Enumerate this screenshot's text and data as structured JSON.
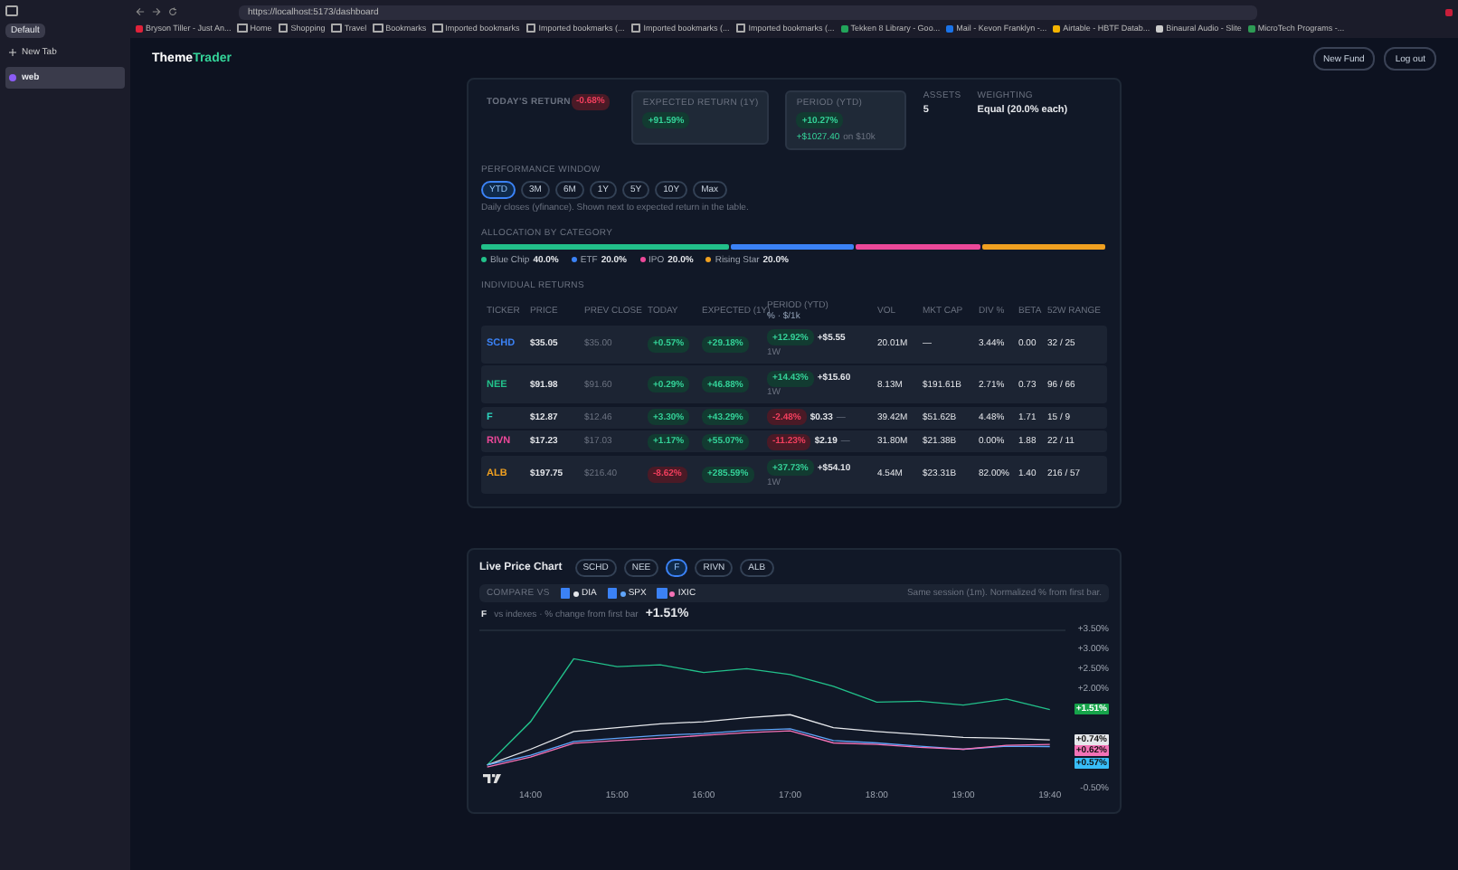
{
  "browser": {
    "url": "https://localhost:5173/dashboard",
    "bookmarks": [
      {
        "label": "Bryson Tiller - Just An...",
        "kind": "site",
        "color": "#e0223a"
      },
      {
        "label": "Home",
        "kind": "folder"
      },
      {
        "label": "Shopping",
        "kind": "folder"
      },
      {
        "label": "Travel",
        "kind": "folder"
      },
      {
        "label": "Bookmarks",
        "kind": "folder"
      },
      {
        "label": "Imported bookmarks",
        "kind": "folder"
      },
      {
        "label": "Imported bookmarks (...",
        "kind": "folder"
      },
      {
        "label": "Imported bookmarks (...",
        "kind": "folder"
      },
      {
        "label": "Imported bookmarks (...",
        "kind": "folder"
      },
      {
        "label": "Tekken 8 Library - Goo...",
        "kind": "site",
        "color": "#22a45a"
      },
      {
        "label": "Mail - Kevon Franklyn -...",
        "kind": "site",
        "color": "#1a73e8"
      },
      {
        "label": "Airtable - HBTF Datab...",
        "kind": "site",
        "color": "#f5b400"
      },
      {
        "label": "Binaural Audio - Slite",
        "kind": "site",
        "color": "#cccccc"
      },
      {
        "label": "MicroTech Programs -...",
        "kind": "site",
        "color": "#2e9b55"
      }
    ]
  },
  "sidebar": {
    "workspace": "Default",
    "new_tab": "New Tab",
    "tabs": [
      {
        "label": "web",
        "selected": true
      }
    ]
  },
  "app": {
    "brand_first": "Theme",
    "brand_second": "Trader",
    "buttons": [
      "New Fund",
      "Log out"
    ]
  },
  "stats": [
    {
      "label": "TODAY'S RETURN",
      "value": "-0.68%",
      "up": false,
      "kind": "pill"
    },
    {
      "label": "EXPECTED RETURN (1Y)",
      "value": "+91.59%",
      "up": true,
      "kind": "boxed"
    },
    {
      "label": "PERIOD (YTD)",
      "value": "+10.27%",
      "up": true,
      "kind": "boxed",
      "amount": "+$1027.40",
      "amount_note": "on $10k"
    },
    {
      "label": "ASSETS",
      "value": "5",
      "kind": "plain"
    },
    {
      "label": "WEIGHTING",
      "value": "Equal (20.0% each)",
      "kind": "plain"
    }
  ],
  "performance": {
    "label": "PERFORMANCE WINDOW",
    "options": [
      {
        "label": "YTD",
        "selected": true
      },
      {
        "label": "3M",
        "selected": false
      },
      {
        "label": "6M",
        "selected": false
      },
      {
        "label": "1Y",
        "selected": false
      },
      {
        "label": "5Y",
        "selected": false
      },
      {
        "label": "10Y",
        "selected": false
      },
      {
        "label": "Max",
        "selected": false
      }
    ],
    "note": "Daily closes (yfinance). Shown next to expected return in the table."
  },
  "allocation": {
    "label": "ALLOCATION BY CATEGORY",
    "categories": [
      {
        "name": "Blue Chip",
        "share": "40.0%",
        "color": "#22c08a"
      },
      {
        "name": "ETF",
        "share": "20.0%",
        "color": "#3b82f6"
      },
      {
        "name": "IPO",
        "share": "20.0%",
        "color": "#ec4899"
      },
      {
        "name": "Rising Star",
        "share": "20.0%",
        "color": "#f0a020"
      }
    ]
  },
  "returns": {
    "label": "INDIVIDUAL RETURNS",
    "columns": [
      "TICKER",
      "PRICE",
      "PREV CLOSE",
      "TODAY",
      "EXPECTED (1Y)",
      "PERIOD (YTD)",
      "VOL",
      "MKT CAP",
      "DIV %",
      "BETA",
      "52W RANGE"
    ],
    "period_sub": "% · $/1k",
    "rows": [
      {
        "ticker": "SCHD",
        "color": "#3b82f6",
        "price": "$35.05",
        "prev_close": "$35.00",
        "today": "+0.57%",
        "today_up": true,
        "expected": "+29.18%",
        "expected_up": true,
        "period": "+12.92%",
        "period_up": true,
        "amount": "+$5.55",
        "note": "1W",
        "vol": "20.01M",
        "mkt_cap": "—",
        "div": "3.44%",
        "beta": "0.00",
        "range": "32 / 25"
      },
      {
        "ticker": "NEE",
        "color": "#22c08a",
        "price": "$91.98",
        "prev_close": "$91.60",
        "today": "+0.29%",
        "today_up": true,
        "expected": "+46.88%",
        "expected_up": true,
        "period": "+14.43%",
        "period_up": true,
        "amount": "+$15.60",
        "note": "1W",
        "vol": "8.13M",
        "mkt_cap": "$191.61B",
        "div": "2.71%",
        "beta": "0.73",
        "range": "96 / 66"
      },
      {
        "ticker": "F",
        "color": "#2dd4bf",
        "price": "$12.87",
        "prev_close": "$12.46",
        "today": "+3.30%",
        "today_up": true,
        "expected": "+43.29%",
        "expected_up": true,
        "period": "-2.48%",
        "period_up": false,
        "amount": "$0.33",
        "note": "—",
        "vol": "39.42M",
        "mkt_cap": "$51.62B",
        "div": "4.48%",
        "beta": "1.71",
        "range": "15 / 9"
      },
      {
        "ticker": "RIVN",
        "color": "#ec4899",
        "price": "$17.23",
        "prev_close": "$17.03",
        "today": "+1.17%",
        "today_up": true,
        "expected": "+55.07%",
        "expected_up": true,
        "period": "-11.23%",
        "period_up": false,
        "amount": "$2.19",
        "note": "—",
        "vol": "31.80M",
        "mkt_cap": "$21.38B",
        "div": "0.00%",
        "beta": "1.88",
        "range": "22 / 11"
      },
      {
        "ticker": "ALB",
        "color": "#f0a020",
        "price": "$197.75",
        "prev_close": "$216.40",
        "today": "-8.62%",
        "today_up": false,
        "expected": "+285.59%",
        "expected_up": true,
        "period": "+37.73%",
        "period_up": true,
        "amount": "+$54.10",
        "note": "1W",
        "vol": "4.54M",
        "mkt_cap": "$23.31B",
        "div": "82.00%",
        "beta": "1.40",
        "range": "216 / 57"
      }
    ]
  },
  "live_chart": {
    "title": "Live Price Chart",
    "tickers": [
      {
        "label": "SCHD",
        "selected": false
      },
      {
        "label": "NEE",
        "selected": false
      },
      {
        "label": "F",
        "selected": true
      },
      {
        "label": "RIVN",
        "selected": false
      },
      {
        "label": "ALB",
        "selected": false
      }
    ],
    "compare_label": "COMPARE VS",
    "compare": [
      {
        "checked": true
      },
      {
        "checked": true
      },
      {
        "checked": true
      }
    ],
    "compare_note": "Same session (1m). Normalized % from first bar.",
    "subtitle": "vs indexes · % change from first bar",
    "change": "+1.51%",
    "chart_data": {
      "type": "line",
      "categories": [
        null,
        "14:00",
        null,
        "15:00",
        null,
        "16:00",
        null,
        "17:00",
        null,
        "18:00",
        null,
        "19:00",
        null,
        "19:40"
      ],
      "series": [
        {
          "name": "F",
          "color": "#22c08a",
          "values": [
            0.1,
            1.2,
            2.8,
            2.6,
            2.65,
            2.45,
            2.55,
            2.4,
            2.1,
            1.7,
            1.72,
            1.62,
            1.78,
            1.51
          ]
        },
        {
          "name": "DIA",
          "color": "#e5e7eb",
          "values": [
            0.1,
            0.5,
            0.95,
            1.05,
            1.15,
            1.2,
            1.3,
            1.38,
            1.05,
            0.95,
            0.88,
            0.8,
            0.78,
            0.74
          ]
        },
        {
          "name": "SPX",
          "color": "#60a5fa",
          "values": [
            0.1,
            0.35,
            0.7,
            0.78,
            0.85,
            0.9,
            0.98,
            1.02,
            0.72,
            0.66,
            0.58,
            0.5,
            0.58,
            0.57
          ]
        },
        {
          "name": "IXIC",
          "color": "#f472b6",
          "values": [
            0.05,
            0.3,
            0.65,
            0.72,
            0.78,
            0.85,
            0.92,
            0.97,
            0.66,
            0.62,
            0.55,
            0.5,
            0.6,
            0.62
          ]
        }
      ],
      "ylim": [
        -0.5,
        3.5
      ],
      "yticks": [
        {
          "value": 3.5,
          "label": "+3.50%"
        },
        {
          "value": 3.0,
          "label": "+3.00%"
        },
        {
          "value": 2.5,
          "label": "+2.50%"
        },
        {
          "value": 2.0,
          "label": "+2.00%"
        },
        {
          "value": -0.5,
          "label": "-0.50%"
        }
      ],
      "value_labels": [
        {
          "label": "+1.51%",
          "color": "#16a34a"
        },
        {
          "label": "+0.74%",
          "color": "#e5e7eb"
        },
        {
          "label": "+0.62%",
          "color": "#f472b6"
        },
        {
          "label": "+0.57%",
          "color": "#38bdf8"
        }
      ]
    }
  }
}
